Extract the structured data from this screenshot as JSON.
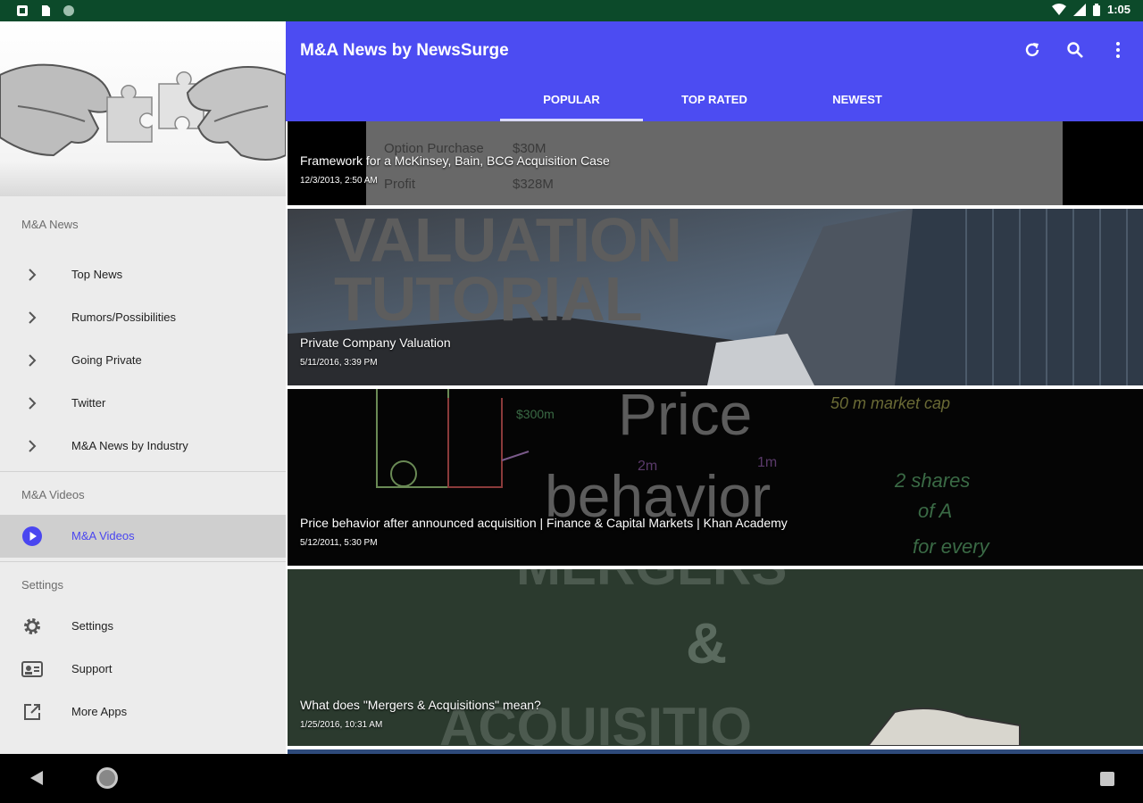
{
  "status_bar": {
    "time": "1:05"
  },
  "app": {
    "title": "M&A News by NewsSurge"
  },
  "tabs": [
    {
      "label": "POPULAR",
      "selected": true
    },
    {
      "label": "TOP RATED",
      "selected": false
    },
    {
      "label": "NEWEST",
      "selected": false
    }
  ],
  "drawer": {
    "sections": [
      {
        "label": "M&A News",
        "items": [
          {
            "label": "Top News",
            "icon": "chevron-right-icon"
          },
          {
            "label": "Rumors/Possibilities",
            "icon": "chevron-right-icon"
          },
          {
            "label": "Going Private",
            "icon": "chevron-right-icon"
          },
          {
            "label": "Twitter",
            "icon": "chevron-right-icon"
          },
          {
            "label": "M&A News by Industry",
            "icon": "chevron-right-icon"
          }
        ]
      },
      {
        "label": "M&A Videos",
        "items": [
          {
            "label": "M&A Videos",
            "icon": "play-circle-icon",
            "active": true
          }
        ]
      },
      {
        "label": "Settings",
        "items": [
          {
            "label": "Settings",
            "icon": "gear-icon"
          },
          {
            "label": "Support",
            "icon": "support-card-icon"
          },
          {
            "label": "More Apps",
            "icon": "open-external-icon"
          }
        ]
      }
    ]
  },
  "videos": [
    {
      "title": "Framework for a McKinsey, Bain, BCG Acquisition Case",
      "date": "12/3/2013, 2:50 AM",
      "thumb_text": [
        "Option Purchase",
        "$30M",
        "Profit",
        "$328M"
      ]
    },
    {
      "title": "Private Company Valuation",
      "date": "5/11/2016, 3:39 PM",
      "thumb_text": [
        "VALUATION",
        "TUTORIAL"
      ]
    },
    {
      "title": "Price behavior after announced acquisition | Finance & Capital Markets | Khan Academy",
      "date": "5/12/2011, 5:30 PM",
      "thumb_text": [
        "Price",
        "behavior",
        "50 m market cap",
        "2 shares",
        "of A",
        "for every",
        "$300m",
        "2m",
        "1m"
      ]
    },
    {
      "title": "What does \"Mergers & Acquisitions\" mean?",
      "date": "1/25/2016, 10:31 AM",
      "thumb_text": [
        "MERGERS",
        "&",
        "ACQUISITIO"
      ]
    }
  ],
  "colors": {
    "primary": "#4c4cf2",
    "status_bar": "#0c4a2a",
    "active_text": "#4a46f0"
  }
}
